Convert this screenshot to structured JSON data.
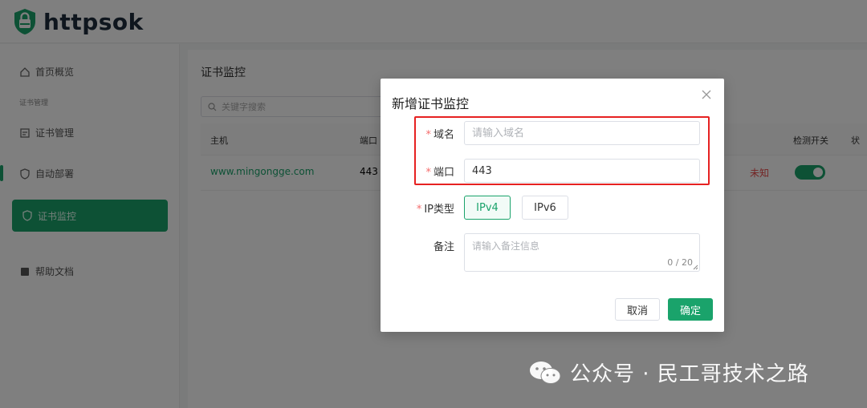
{
  "brand": {
    "name": "httpsok"
  },
  "sidebar": {
    "items": [
      {
        "label": "首页概览",
        "icon": "home-icon"
      },
      {
        "label": "证书管理",
        "icon": "certificate-icon"
      },
      {
        "label": "自动部署",
        "icon": "shield-icon"
      },
      {
        "label": "证书监控",
        "icon": "monitor-icon",
        "active": true
      },
      {
        "label": "帮助文档",
        "icon": "book-icon"
      }
    ],
    "group_label": "证书管理"
  },
  "main": {
    "page_title": "证书监控",
    "search_placeholder": "关键字搜索",
    "columns": [
      "主机",
      "端口",
      "检测开关",
      "状"
    ],
    "rows": [
      {
        "host": "www.mingongge.com",
        "port": "443",
        "status": "未知",
        "enabled": true
      }
    ]
  },
  "dialog": {
    "title": "新增证书监控",
    "fields": {
      "domain": {
        "label": "域名",
        "placeholder": "请输入域名",
        "value": ""
      },
      "port": {
        "label": "端口",
        "value": "443"
      },
      "ip_type": {
        "label": "IP类型",
        "options": [
          "IPv4",
          "IPv6"
        ],
        "selected": "IPv4"
      },
      "note": {
        "label": "备注",
        "placeholder": "请输入备注信息",
        "counter": "0 / 20"
      }
    },
    "required_mark": "*",
    "buttons": {
      "cancel": "取消",
      "confirm": "确定"
    }
  },
  "watermark": {
    "text": "公众号 · 民工哥技术之路"
  },
  "colors": {
    "accent": "#1aa36b",
    "highlight": "#e62121",
    "danger": "#e84a4a"
  }
}
